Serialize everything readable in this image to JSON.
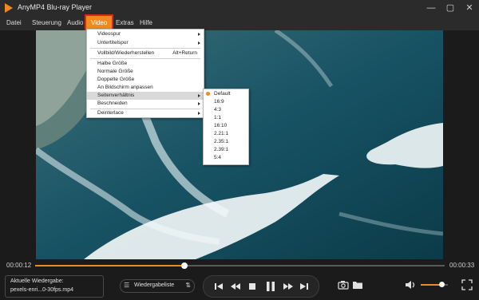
{
  "window": {
    "title": "AnyMP4 Blu-ray Player",
    "controls": [
      "—",
      "▢",
      "✕"
    ]
  },
  "menubar": {
    "items": [
      "Datei",
      "Steuerung",
      "Audio",
      "Video",
      "Extras",
      "Hilfe"
    ]
  },
  "video_menu": {
    "items": [
      {
        "label": "Videospur",
        "submenu": true
      },
      {
        "label": "Untertitelspur",
        "submenu": true
      },
      {
        "label": "Vollbild/Wiederherstellen",
        "shortcut": "Alt+Return"
      },
      {
        "label": "Halbe Größe"
      },
      {
        "label": "Normale Größe"
      },
      {
        "label": "Doppelte Größe"
      },
      {
        "label": "An Bildschirm anpassen"
      },
      {
        "label": "Seitenverhältnis",
        "submenu": true
      },
      {
        "label": "Beschneiden",
        "submenu": true
      },
      {
        "label": "Deinterlace",
        "submenu": true
      }
    ]
  },
  "aspect_submenu": {
    "items": [
      "Default",
      "16:9",
      "4:3",
      "1:1",
      "16:10",
      "2.21:1",
      "2.35:1",
      "2.39:1",
      "5:4"
    ],
    "selected": "Default"
  },
  "playback": {
    "current_time": "00:00:12",
    "total_time": "00:00:33",
    "progress": 0.3636,
    "volume": 0.75
  },
  "now_playing": {
    "label": "Aktuelle Wiedergabe:",
    "file": "pexels-enri...0-30fps.mp4"
  },
  "playlist": {
    "label": "Wiedergabeliste"
  },
  "colors": {
    "accent": "#f08a1c",
    "highlight_border": "#d12c1c",
    "background": "#1b1b1b"
  }
}
